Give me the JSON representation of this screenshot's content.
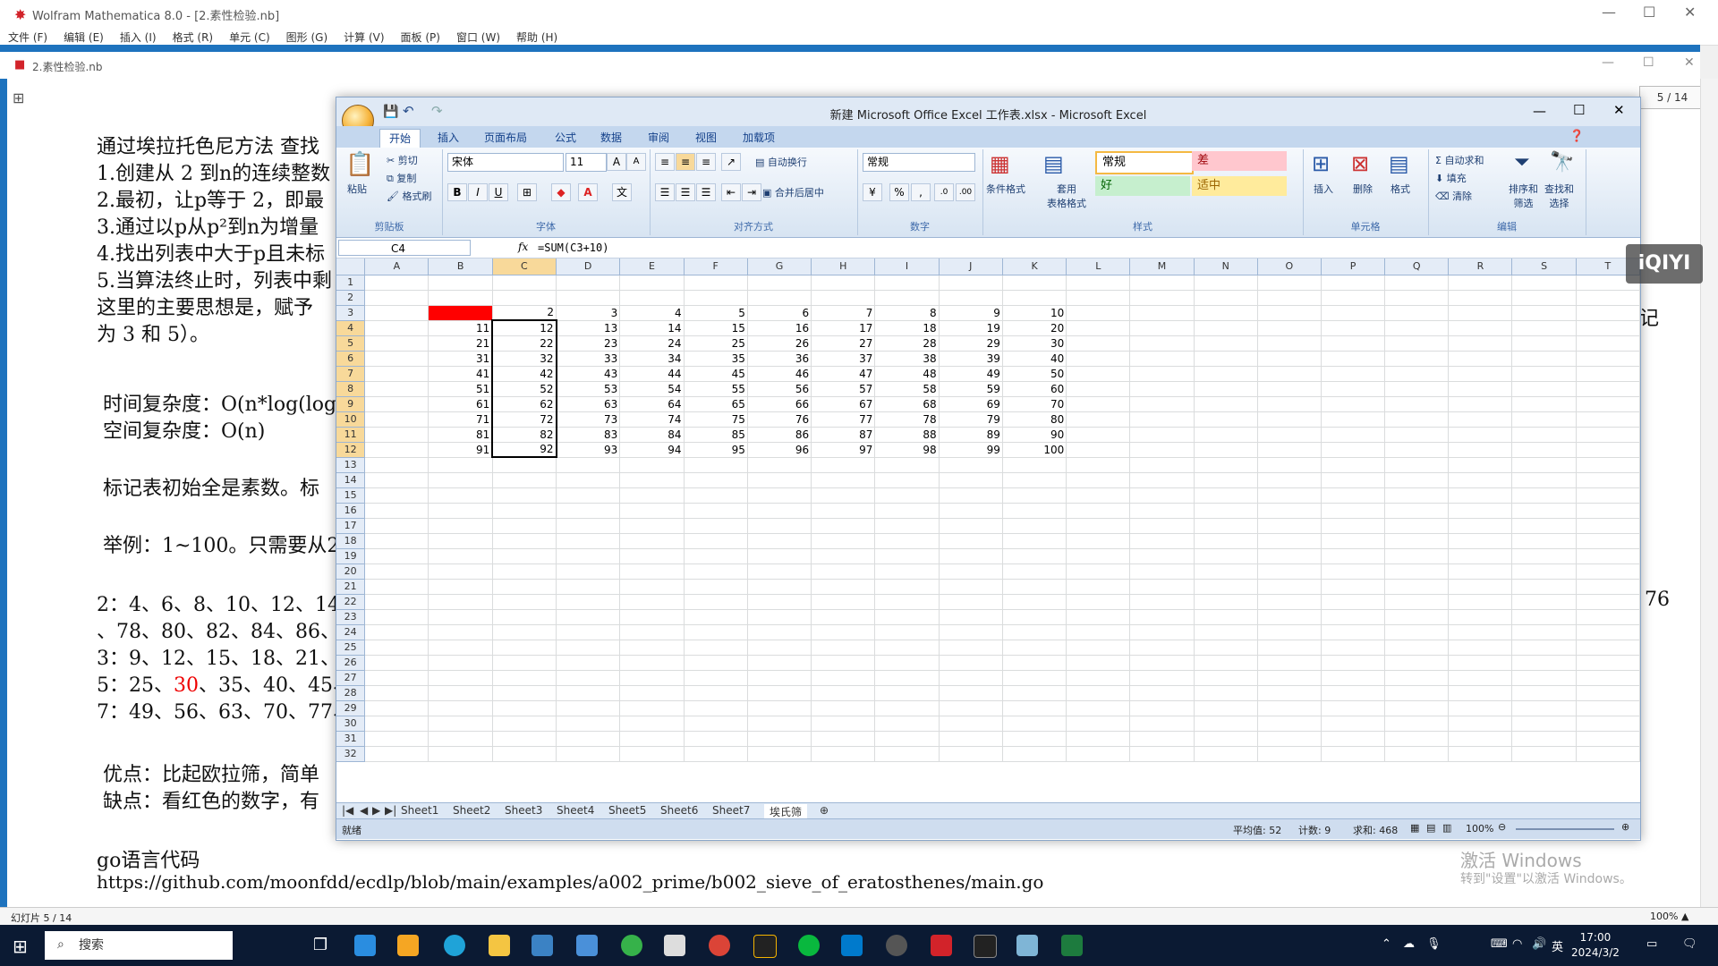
{
  "mathematica": {
    "title": "Wolfram Mathematica 8.0 - [2.素性检验.nb]",
    "menu": [
      "文件 (F)",
      "编辑 (E)",
      "插入 (I)",
      "格式 (R)",
      "单元 (C)",
      "图形 (G)",
      "计算 (V)",
      "面板 (P)",
      "窗口 (W)",
      "帮助 (H)"
    ],
    "notebook_title": "2.素性检验.nb",
    "slide_counter": "5 / 14",
    "lines": [
      "通过埃拉托色尼方法 查找",
      "1.创建从 2 到n的连续整数",
      "2.最初，让p等于 2，即最",
      "3.通过以p从p²到n为增量",
      "4.找出列表中大于p且未标",
      "5.当算法终止时，列表中剩",
      "这里的主要思想是，赋予",
      "为 3 和 5）。",
      "时间复杂度：O(n*log(log",
      "空间复杂度：O(n)",
      "标记表初始全是素数。标",
      "举例：1~100。只需要从2",
      "2：4、6、8、10、12、14",
      "、78、80、82、84、86、",
      "3：9、12、15、18、21、",
      "5：25、30、35、40、45、",
      "7：49、56、63、70、77、",
      "优点：比起欧拉筛，简单",
      "缺点：看红色的数字，有",
      "go语言代码",
      "https://github.com/moonfdd/ecdlp/blob/main/examples/a002_prime/b002_sieve_of_eratosthenes/main.go"
    ],
    "right_fragment_1": "记",
    "right_fragment_2": "76",
    "red_number": "30",
    "status_left": "幻灯片 5 / 14",
    "status_right": "100% ▲",
    "watermark_1": "激活 Windows",
    "watermark_2": "转到\"设置\"以激活 Windows。"
  },
  "excel": {
    "title": "新建 Microsoft Office Excel 工作表.xlsx - Microsoft Excel",
    "tabs": [
      "开始",
      "插入",
      "页面布局",
      "公式",
      "数据",
      "审阅",
      "视图",
      "加载项"
    ],
    "clipboard": {
      "paste": "粘贴",
      "cut": "剪切",
      "copy": "复制",
      "format_painter": "格式刷",
      "label": "剪贴板"
    },
    "font": {
      "name": "宋体",
      "size": "11",
      "label": "字体"
    },
    "alignment": {
      "wrap": "自动换行",
      "merge": "合并后居中",
      "label": "对齐方式"
    },
    "number": {
      "format": "常规",
      "label": "数字"
    },
    "styles": {
      "conditional": "条件格式",
      "table": "套用\n表格格式",
      "normal": "常规",
      "bad": "差",
      "good": "好",
      "neutral": "适中",
      "label": "样式"
    },
    "cells": {
      "insert": "插入",
      "delete": "删除",
      "format": "格式",
      "label": "单元格"
    },
    "editing": {
      "autosum": "自动求和",
      "fill": "填充",
      "clear": "清除",
      "sort": "排序和\n筛选",
      "find": "查找和\n选择",
      "label": "编辑"
    },
    "namebox": "C4",
    "formula": "=SUM(C3+10)",
    "columns": [
      "A",
      "B",
      "C",
      "D",
      "E",
      "F",
      "G",
      "H",
      "I",
      "J",
      "K",
      "L",
      "M",
      "N",
      "O",
      "P",
      "Q",
      "R",
      "S",
      "T"
    ],
    "rows": [
      [],
      [],
      [
        "",
        "",
        "2",
        "3",
        "4",
        "5",
        "6",
        "7",
        "8",
        "9",
        "10"
      ],
      [
        "",
        "11",
        "12",
        "13",
        "14",
        "15",
        "16",
        "17",
        "18",
        "19",
        "20"
      ],
      [
        "",
        "21",
        "22",
        "23",
        "24",
        "25",
        "26",
        "27",
        "28",
        "29",
        "30"
      ],
      [
        "",
        "31",
        "32",
        "33",
        "34",
        "35",
        "36",
        "37",
        "38",
        "39",
        "40"
      ],
      [
        "",
        "41",
        "42",
        "43",
        "44",
        "45",
        "46",
        "47",
        "48",
        "49",
        "50"
      ],
      [
        "",
        "51",
        "52",
        "53",
        "54",
        "55",
        "56",
        "57",
        "58",
        "59",
        "60"
      ],
      [
        "",
        "61",
        "62",
        "63",
        "64",
        "65",
        "66",
        "67",
        "68",
        "69",
        "70"
      ],
      [
        "",
        "71",
        "72",
        "73",
        "74",
        "75",
        "76",
        "77",
        "78",
        "79",
        "80"
      ],
      [
        "",
        "81",
        "82",
        "83",
        "84",
        "85",
        "86",
        "87",
        "88",
        "89",
        "90"
      ],
      [
        "",
        "91",
        "92",
        "93",
        "94",
        "95",
        "96",
        "97",
        "98",
        "99",
        "100"
      ]
    ],
    "total_rows": 32,
    "sheets": [
      "Sheet1",
      "Sheet2",
      "Sheet3",
      "Sheet4",
      "Sheet5",
      "Sheet6",
      "Sheet7",
      "埃氏筛"
    ],
    "status_ready": "就绪",
    "status_avg": "平均值: 52",
    "status_count": "计数: 9",
    "status_sum": "求和: 468",
    "zoom": "100%"
  },
  "overlay": {
    "iqiyi": "iQIYI"
  },
  "taskbar": {
    "search": "搜索",
    "time": "17:00",
    "date": "2024/3/2",
    "ime": "英"
  },
  "colors": {
    "accent": "#1e73be",
    "taskbar": "#0b1a33",
    "red_cell": "#ff0000",
    "excel_ribbon": "#dfe9f5"
  }
}
